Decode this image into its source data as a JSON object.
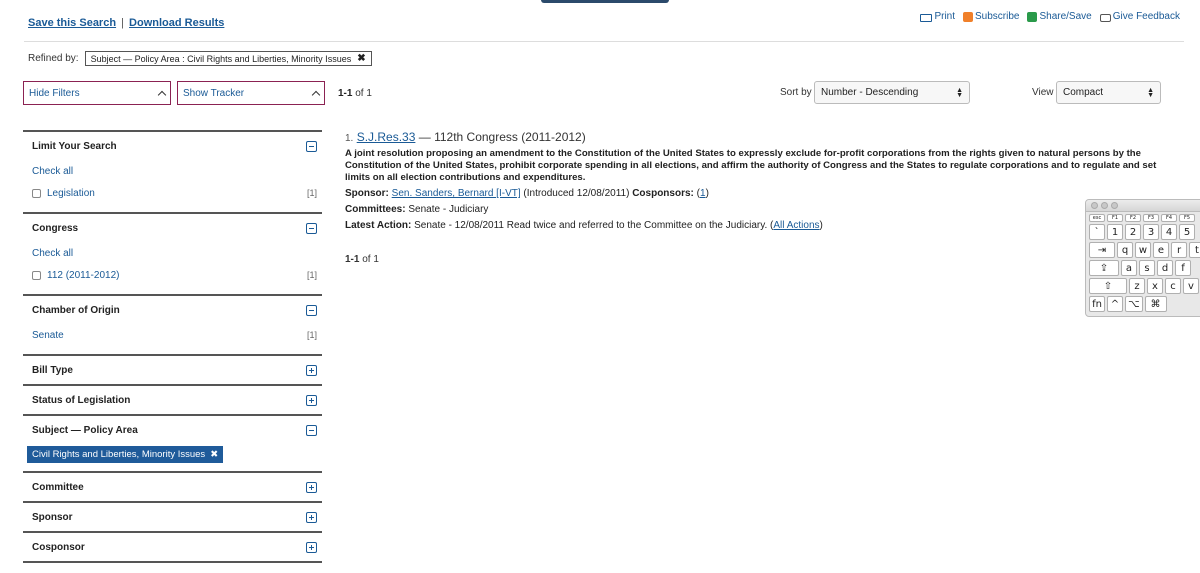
{
  "header": {
    "save_search": "Save this Search",
    "separator": "|",
    "download": "Download Results",
    "tools": [
      {
        "label": "Print",
        "icon": "print-icon"
      },
      {
        "label": "Subscribe",
        "icon": "rss-icon"
      },
      {
        "label": "Share/Save",
        "icon": "share-icon"
      },
      {
        "label": "Give Feedback",
        "icon": "feedback-icon"
      }
    ]
  },
  "refined": {
    "label": "Refined by:",
    "tag": "Subject — Policy Area : Civil Rights and Liberties, Minority Issues",
    "remove": "✖"
  },
  "controls": {
    "hide_filters": "Hide Filters",
    "show_tracker": "Show Tracker",
    "count_range": "1-1",
    "count_of": "of 1",
    "sort_label": "Sort by",
    "sort_value": "Number - Descending",
    "view_label": "View",
    "view_value": "Compact"
  },
  "sidebar": {
    "limit": {
      "title": "Limit Your Search",
      "check_all": "Check all",
      "items": [
        {
          "label": "Legislation",
          "count": "[1]"
        }
      ]
    },
    "congress": {
      "title": "Congress",
      "check_all": "Check all",
      "items": [
        {
          "label": "112 (2011-2012)",
          "count": "[1]"
        }
      ]
    },
    "chamber": {
      "title": "Chamber of Origin",
      "items": [
        {
          "label": "Senate",
          "count": "[1]"
        }
      ]
    },
    "bill_type": {
      "title": "Bill Type"
    },
    "status": {
      "title": "Status of Legislation"
    },
    "subject": {
      "title": "Subject — Policy Area",
      "active": "Civil Rights and Liberties, Minority Issues",
      "remove": "✖"
    },
    "committee": {
      "title": "Committee"
    },
    "sponsor": {
      "title": "Sponsor"
    },
    "cosponsor": {
      "title": "Cosponsor"
    }
  },
  "result": {
    "index": "1.",
    "bill": "S.J.Res.33",
    "congress": "— 112th Congress (2011-2012)",
    "description": "A joint resolution proposing an amendment to the Constitution of the United States to expressly exclude for-profit corporations from the rights given to natural persons by the Constitution of the United States, prohibit corporate spending in all elections, and affirm the authority of Congress and the States to regulate corporations and to regulate and set limits on all election contributions and expenditures.",
    "sponsor_label": "Sponsor:",
    "sponsor": "Sen. Sanders, Bernard [I-VT]",
    "introduced": "(Introduced 12/08/2011)",
    "cosponsors_label": "Cosponsors:",
    "cosponsors_open": "(",
    "cosponsors": "1",
    "cosponsors_close": ")",
    "committees_label": "Committees:",
    "committees": "Senate - Judiciary",
    "action_label": "Latest Action:",
    "action": "Senate - 12/08/2011 Read twice and referred to the Committee on the Judiciary. (",
    "all_actions": "All Actions",
    "action_close": ")"
  },
  "footer_count": {
    "range": "1-1",
    "of": "of 1"
  },
  "keyboard": {
    "fkeys": [
      "esc",
      "F1",
      "F2",
      "F3",
      "F4",
      "F5"
    ],
    "row1": [
      "`",
      "1",
      "2",
      "3",
      "4",
      "5"
    ],
    "row2": [
      "⇥",
      "q",
      "w",
      "e",
      "r",
      "t"
    ],
    "row3": [
      "⇪",
      "a",
      "s",
      "d",
      "f"
    ],
    "row4": [
      "⇧",
      "z",
      "x",
      "c",
      "v"
    ],
    "row5": [
      "fn",
      "^",
      "⌥",
      "⌘"
    ]
  }
}
